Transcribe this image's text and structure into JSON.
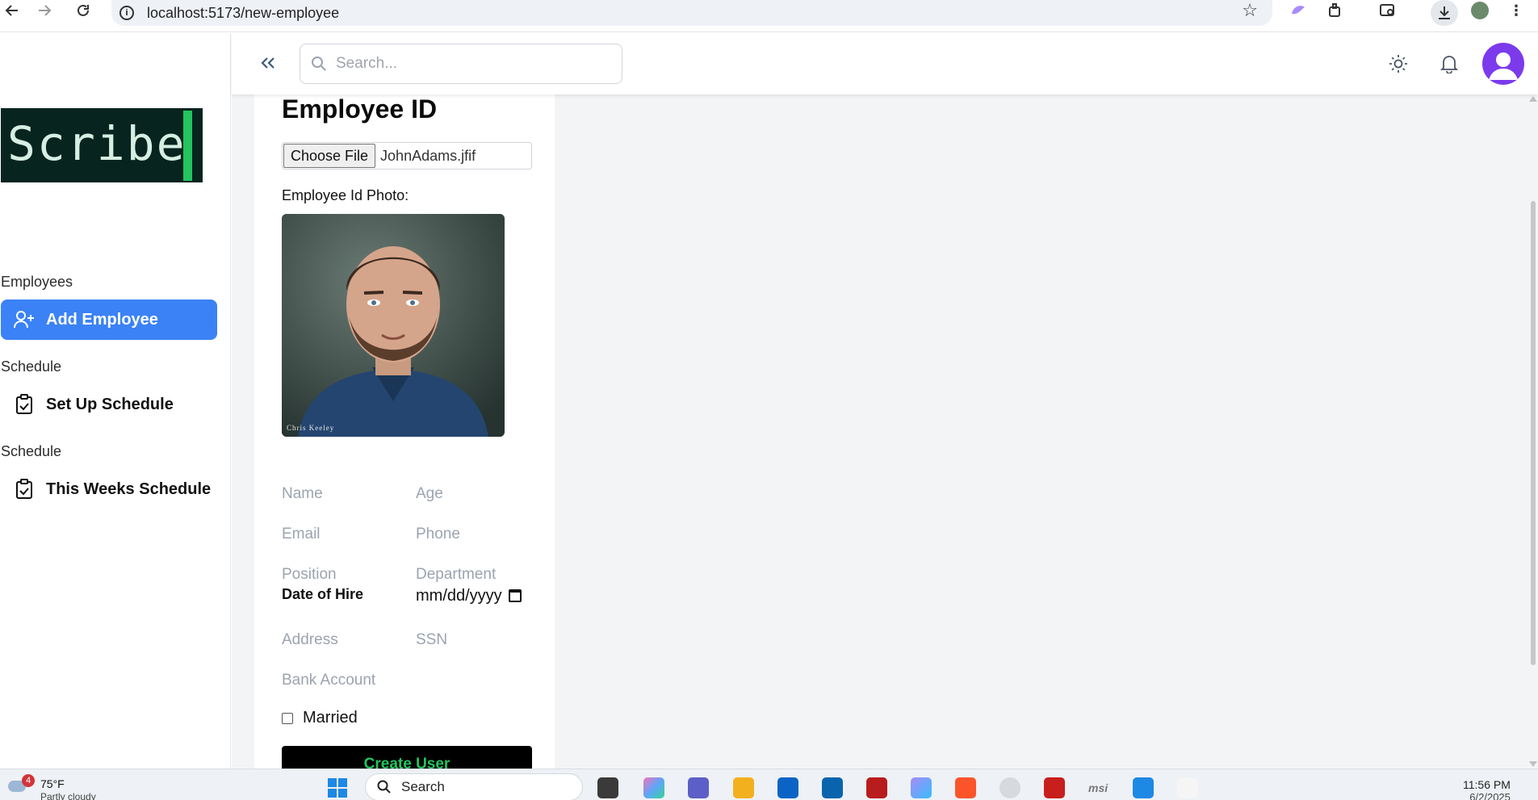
{
  "browser": {
    "url": "localhost:5173/new-employee"
  },
  "sidebar": {
    "logo_text": "Scribe",
    "sections": [
      {
        "label": "Employees",
        "item": "Add Employee",
        "icon": "user-plus-icon",
        "active": true
      },
      {
        "label": "Schedule",
        "item": "Set Up Schedule",
        "icon": "clipboard-check-icon",
        "active": false
      },
      {
        "label": "Schedule",
        "item": "This Weeks Schedule",
        "icon": "clipboard-check-icon",
        "active": false
      }
    ]
  },
  "header": {
    "search_placeholder": "Search..."
  },
  "form": {
    "title": "Employee ID",
    "file_button": "Choose File",
    "file_name": "JohnAdams.jfif",
    "photo_label": "Employee Id Photo:",
    "photo_caption": "Chris Keeley",
    "fields": {
      "name": "Name",
      "age": "Age",
      "email": "Email",
      "phone": "Phone",
      "position": "Position",
      "department": "Department",
      "address": "Address",
      "ssn": "SSN",
      "bank_account": "Bank Account"
    },
    "date_label": "Date of Hire",
    "date_placeholder": "mm/dd/yyyy",
    "married_label": "Married",
    "submit_label": "Create User"
  },
  "taskbar": {
    "weather_badge": "4",
    "temperature": "75°F",
    "condition": "Partly cloudy",
    "search_label": "Search",
    "time": "11:56 PM",
    "date": "6/2/2025"
  },
  "colors": {
    "accent": "#3b82f6",
    "logo_bg": "#07241f",
    "logo_cursor": "#22c55e",
    "avatar": "#7c3aed",
    "submit_bg": "#000000",
    "submit_text": "#22c55e"
  }
}
